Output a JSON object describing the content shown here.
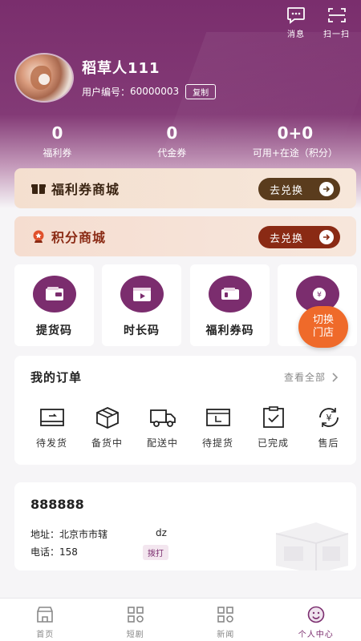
{
  "header": {
    "message_label": "消息",
    "scan_label": "扫一扫"
  },
  "profile": {
    "username": "稻草人111",
    "userid_label": "用户编号：",
    "userid_value": "60000003",
    "copy_label": "复制"
  },
  "stats": [
    {
      "value": "0",
      "label": "福利券"
    },
    {
      "value": "0",
      "label": "代金券"
    },
    {
      "value": "0+0",
      "label": "可用+在途（积分）"
    }
  ],
  "malls": [
    {
      "title": "福利券商城",
      "button": "去兑换"
    },
    {
      "title": "积分商城",
      "button": "去兑换"
    }
  ],
  "quick": [
    {
      "label": "提货码",
      "icon": "wallet-icon"
    },
    {
      "label": "时长码",
      "icon": "video-icon"
    },
    {
      "label": "福利券码",
      "icon": "ticket-icon"
    },
    {
      "label": "",
      "icon": "yuan-icon"
    }
  ],
  "switch_store": {
    "line1": "切换",
    "line2": "门店"
  },
  "orders": {
    "title": "我的订单",
    "view_all": "查看全部",
    "items": [
      {
        "label": "待发货",
        "icon": "pending-ship-icon"
      },
      {
        "label": "备货中",
        "icon": "box-icon"
      },
      {
        "label": "配送中",
        "icon": "truck-icon"
      },
      {
        "label": "待提货",
        "icon": "pickup-icon"
      },
      {
        "label": "已完成",
        "icon": "completed-icon"
      },
      {
        "label": "售后",
        "icon": "after-sale-icon"
      }
    ]
  },
  "address": {
    "name": "888888",
    "address_label": "地址：",
    "address_value": "北京市市辖",
    "address_extra": "dz",
    "phone_label": "电话：",
    "phone_value": "158",
    "call_label": "拨打"
  },
  "tabs": [
    {
      "label": "首页",
      "icon": "home-icon"
    },
    {
      "label": "短剧",
      "icon": "grid-icon"
    },
    {
      "label": "新闻",
      "icon": "news-icon"
    },
    {
      "label": "个人中心",
      "icon": "user-icon"
    }
  ],
  "colors": {
    "brand": "#7b2d6e",
    "switch_store": "#ef6a2a",
    "exchange_dark": "#5a3c1d",
    "exchange_red": "#8a2a14"
  }
}
